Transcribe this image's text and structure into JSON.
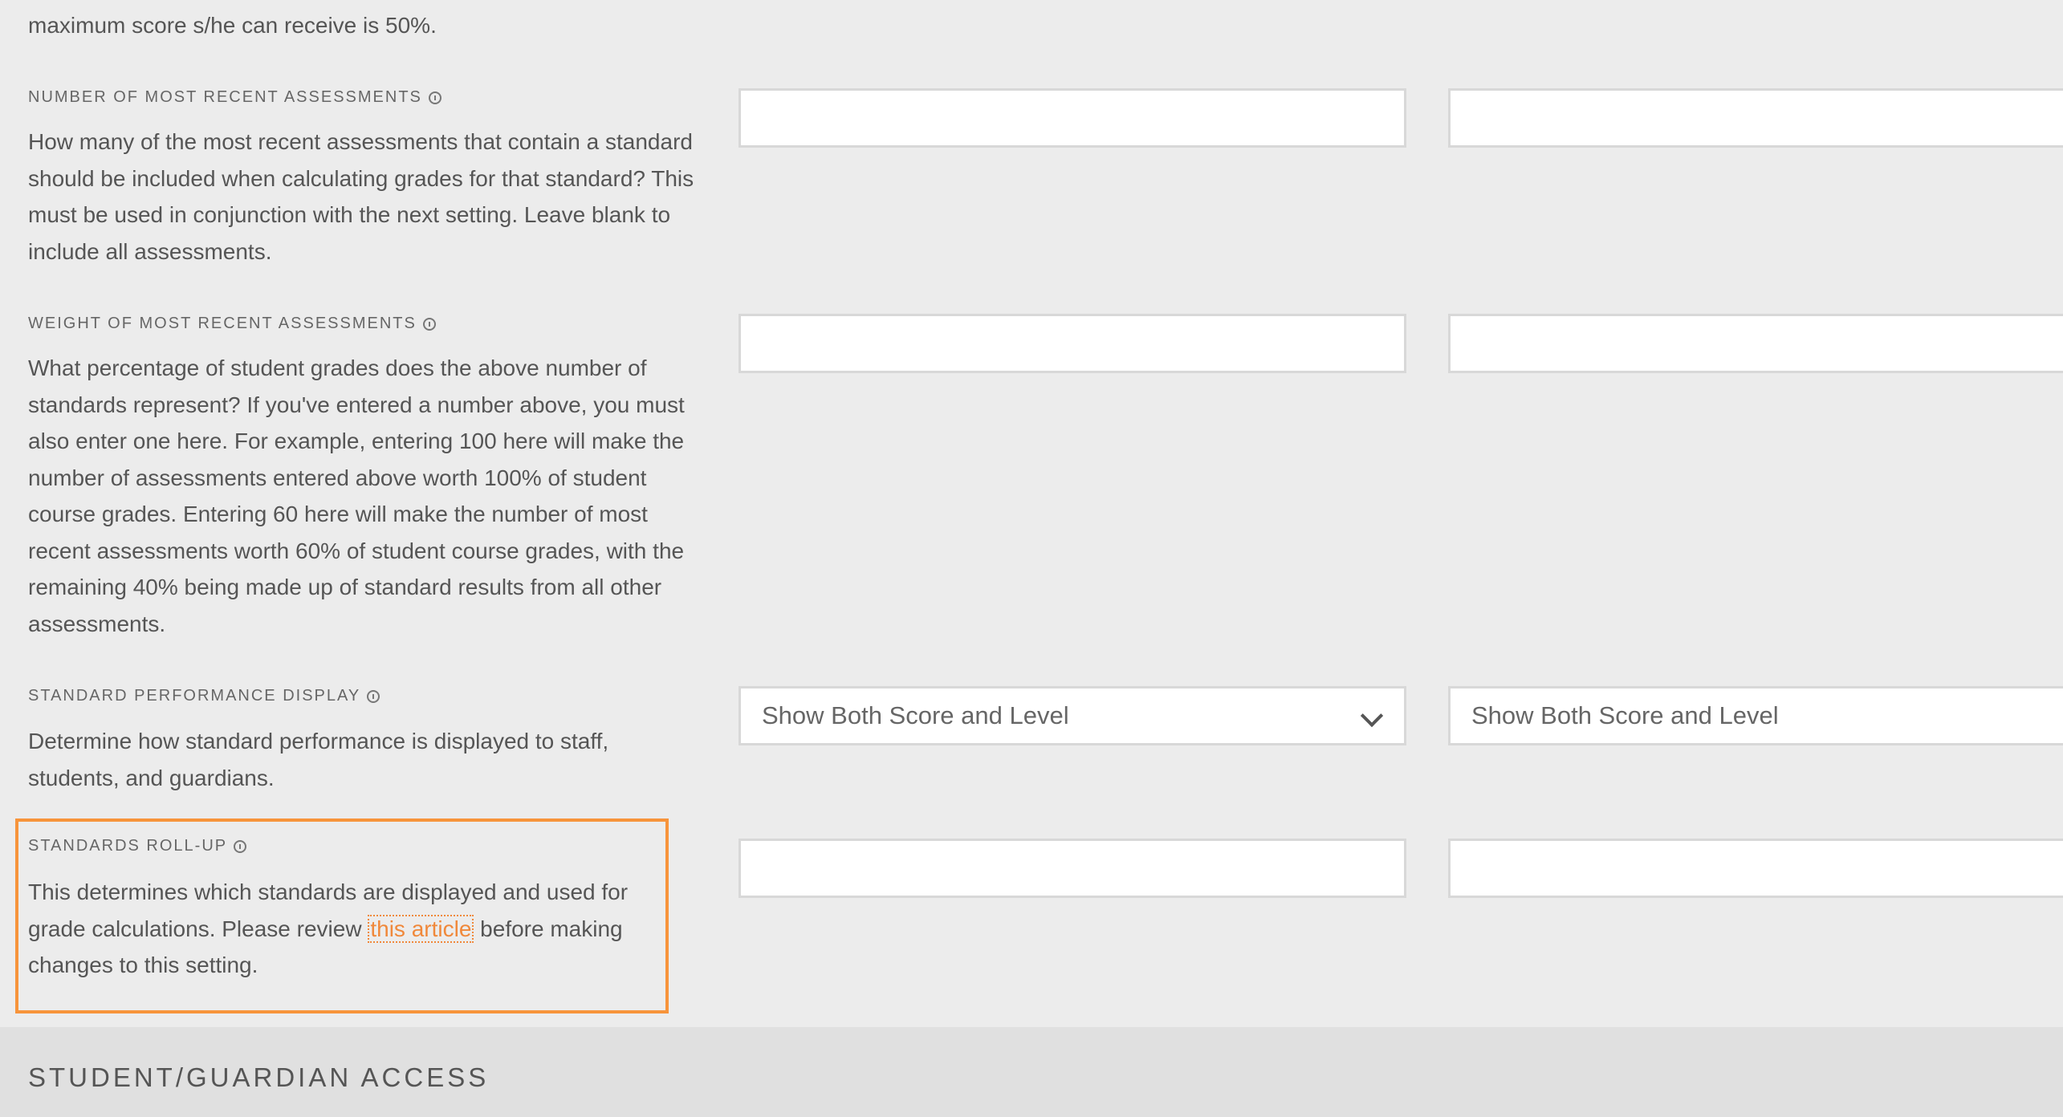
{
  "top_fragment": {
    "line2": "maximum score s/he can receive is 50%."
  },
  "settings": {
    "recent_count": {
      "label": "NUMBER OF MOST RECENT ASSESSMENTS",
      "description": "How many of the most recent assessments that contain a standard should be included when calculating grades for that standard? This must be used in conjunction with the next setting. Leave blank to include all assessments.",
      "col1_value": "",
      "col2_value": ""
    },
    "recent_weight": {
      "label": "WEIGHT OF MOST RECENT ASSESSMENTS",
      "description": "What percentage of student grades does the above number of standards represent? If you've entered a number above, you must also enter one here. For example, entering 100 here will make the number of assessments entered above worth 100% of student course grades. Entering 60 here will make the number of most recent assessments worth 60% of student course grades, with the remaining 40% being made up of standard results from all other assessments.",
      "col1_value": "",
      "col2_value": ""
    },
    "performance_display": {
      "label": "STANDARD PERFORMANCE DISPLAY",
      "description": "Determine how standard performance is displayed to staff, students, and guardians.",
      "col1_value": "Show Both Score and Level",
      "col2_value": "Show Both Score and Level"
    },
    "rollup": {
      "label": "STANDARDS ROLL-UP",
      "description_before": "This determines which standards are displayed and used for grade calculations. Please review ",
      "link_text": "this article",
      "description_after": " before making changes to this setting.",
      "col1_value": "",
      "col2_value": ""
    }
  },
  "section": {
    "title": "STUDENT/GUARDIAN ACCESS"
  },
  "icons": {
    "info": "info-icon",
    "dropdown": "chevron-down-icon"
  },
  "colors": {
    "highlight": "#f7943b",
    "link": "#f0883a"
  }
}
